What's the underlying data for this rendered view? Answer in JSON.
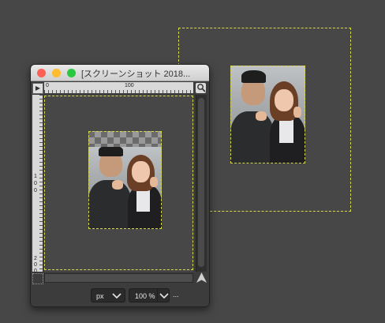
{
  "window": {
    "title": "[スクリーンショット 2018...",
    "traffic_lights": {
      "close": "#fe5f57",
      "minimize": "#febc2e",
      "zoom": "#28c840"
    }
  },
  "ruler": {
    "top_labels": [
      "0",
      "100"
    ],
    "left_labels": [
      "1",
      "0",
      "0",
      "2",
      "0",
      "0"
    ]
  },
  "status": {
    "unit": "px",
    "zoom": "100 %",
    "more": "..."
  },
  "icons": {
    "menu": "triangle-menu-icon",
    "zoom_toggle": "magnifier-icon",
    "quick_mask": "quick-mask-icon",
    "navigate": "navigate-icon",
    "chevron": "chevron-down-icon"
  },
  "colors": {
    "canvas_bg": "#474747",
    "layer_boundary": "#d8d84a"
  }
}
